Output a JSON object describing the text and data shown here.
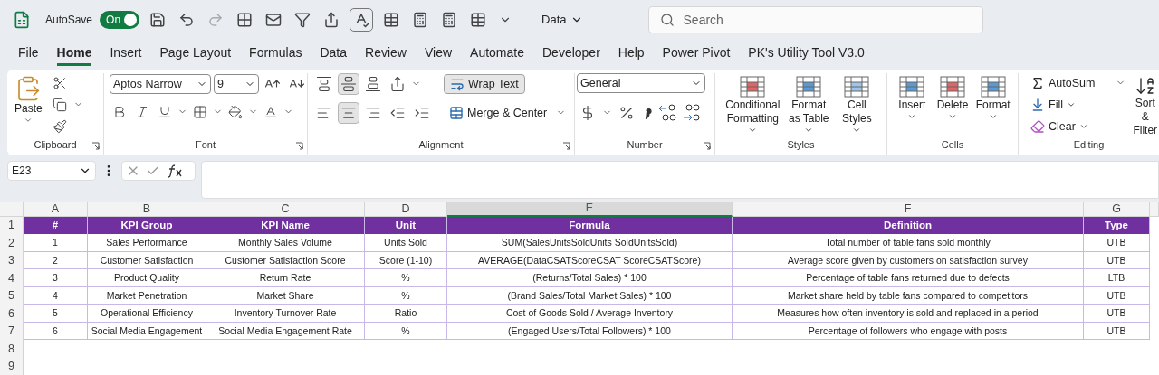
{
  "title_bar": {
    "autosave": {
      "label": "AutoSave",
      "state_text": "On",
      "on": true
    },
    "file_menu": "Data",
    "search": {
      "placeholder": "Search"
    }
  },
  "tabs": [
    {
      "label": "File",
      "selected": false
    },
    {
      "label": "Home",
      "selected": true
    },
    {
      "label": "Insert",
      "selected": false
    },
    {
      "label": "Page Layout",
      "selected": false
    },
    {
      "label": "Formulas",
      "selected": false
    },
    {
      "label": "Data",
      "selected": false
    },
    {
      "label": "Review",
      "selected": false
    },
    {
      "label": "View",
      "selected": false
    },
    {
      "label": "Automate",
      "selected": false
    },
    {
      "label": "Developer",
      "selected": false
    },
    {
      "label": "Help",
      "selected": false
    },
    {
      "label": "Power Pivot",
      "selected": false
    },
    {
      "label": "PK's Utility Tool V3.0",
      "selected": false
    }
  ],
  "ribbon": {
    "clipboard": {
      "label": "Clipboard",
      "paste": "Paste"
    },
    "font": {
      "label": "Font",
      "font_name": "Aptos Narrow",
      "font_size": "9"
    },
    "alignment": {
      "label": "Alignment",
      "middle_align_on": true,
      "center_align_on": true,
      "wrap_text": {
        "label": "Wrap Text",
        "on": true
      },
      "merge": "Merge & Center"
    },
    "number": {
      "label": "Number",
      "format": "General"
    },
    "styles": {
      "label": "Styles",
      "buttons": [
        "Conditional Formatting",
        "Format as Table",
        "Cell Styles"
      ]
    },
    "cells": {
      "label": "Cells",
      "buttons": [
        "Insert",
        "Delete",
        "Format"
      ]
    },
    "editing": {
      "label": "Editing",
      "autosum": "AutoSum",
      "fill": "Fill",
      "clear": "Clear",
      "sort": "Sort & Filter"
    }
  },
  "formula_bar": {
    "name_box": "E23"
  },
  "sheet": {
    "columns": [
      {
        "letter": "A",
        "selected": false
      },
      {
        "letter": "B",
        "selected": false
      },
      {
        "letter": "C",
        "selected": false
      },
      {
        "letter": "D",
        "selected": false
      },
      {
        "letter": "E",
        "selected": true
      },
      {
        "letter": "F",
        "selected": false
      },
      {
        "letter": "G",
        "selected": false
      }
    ],
    "row_numbers": [
      "1",
      "2",
      "3",
      "4",
      "5",
      "6",
      "7",
      "8",
      "9"
    ],
    "header": [
      "#",
      "KPI Group",
      "KPI Name",
      "Unit",
      "Formula",
      "Definition",
      "Type"
    ],
    "rows": [
      [
        "1",
        "Sales Performance",
        "Monthly Sales Volume",
        "Units Sold",
        "SUM(SalesUnitsSoldUnits SoldUnitsSold)",
        "Total number of table fans sold monthly",
        "UTB"
      ],
      [
        "2",
        "Customer Satisfaction",
        "Customer Satisfaction Score",
        "Score (1-10)",
        "AVERAGE(DataCSATScoreCSAT ScoreCSATScore)",
        "Average score given by customers on satisfaction survey",
        "UTB"
      ],
      [
        "3",
        "Product Quality",
        "Return Rate",
        "%",
        "(Returns/Total Sales) * 100",
        "Percentage of table fans returned due to defects",
        "LTB"
      ],
      [
        "4",
        "Market Penetration",
        "Market Share",
        "%",
        "(Brand Sales/Total Market Sales) * 100",
        "Market share held by table fans compared to competitors",
        "UTB"
      ],
      [
        "5",
        "Operational Efficiency",
        "Inventory Turnover Rate",
        "Ratio",
        "Cost of Goods Sold / Average Inventory",
        "Measures how often inventory is sold and replaced in a period",
        "UTB"
      ],
      [
        "6",
        "Social Media Engagement",
        "Social Media Engagement Rate",
        "%",
        "(Engaged Users/Total Followers) * 100",
        "Percentage of followers who engage with posts",
        "UTB"
      ]
    ]
  }
}
